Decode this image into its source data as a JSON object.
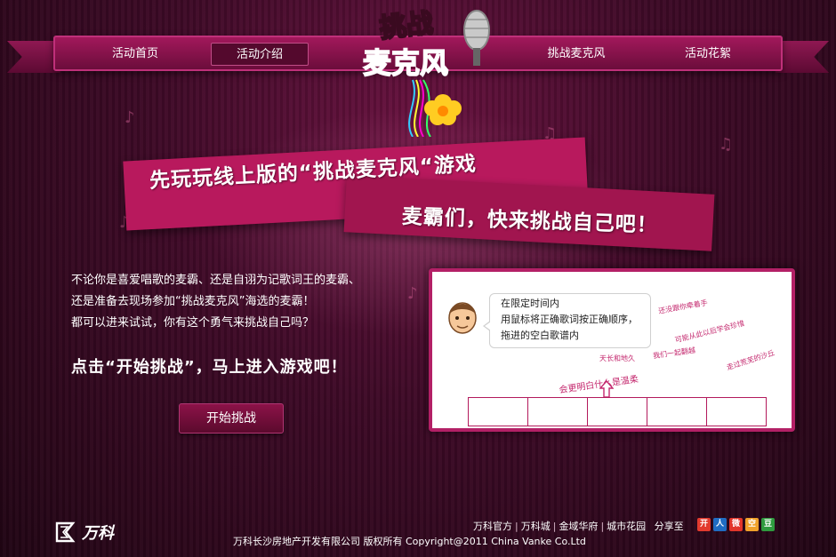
{
  "nav": {
    "items": [
      {
        "label": "活动首页"
      },
      {
        "label": "活动介绍"
      },
      {
        "label": "挑战麦克风"
      },
      {
        "label": "活动花絮"
      }
    ],
    "active": "活动介绍"
  },
  "logo": {
    "line1": "挑战",
    "line2": "麦克风"
  },
  "banner": {
    "line1": "先玩玩线上版的“挑战麦克风“游戏",
    "line2": "麦霸们，快来挑战自己吧！"
  },
  "intro": {
    "lines": [
      "不论你是喜爱唱歌的麦霸、还是自诩为记歌词王的麦霸、",
      "还是准备去现场参加“挑战麦克风”海选的麦霸！",
      "都可以进来试试，你有这个勇气来挑战自己吗？"
    ],
    "call_to_action": "点击“开始挑战”，马上进入游戏吧！"
  },
  "start_button": {
    "label": "开始挑战"
  },
  "preview": {
    "bubble_lines": [
      "在限定时间内",
      "用鼠标将正确歌词按正确顺序，",
      "拖进的空白歌谱内"
    ],
    "lyrics": [
      "还没跟你牵着手",
      "可能从此以后学会珍惜",
      "走过荒芜的沙丘",
      "天长和地久",
      "我们一起翻越"
    ],
    "main_lyric": "会更明白什么是温柔",
    "slot_count": 5
  },
  "footer": {
    "brand": "万科",
    "links": [
      "万科官方",
      "万科城",
      "金域华府",
      "城市花园"
    ],
    "share_label": "分享至",
    "share_icons": [
      {
        "name": "kaixin-icon",
        "glyph": "开",
        "color": "#e23a2e"
      },
      {
        "name": "renren-icon",
        "glyph": "人",
        "color": "#1f6cc2"
      },
      {
        "name": "weibo-icon",
        "glyph": "微",
        "color": "#e2352a"
      },
      {
        "name": "qzone-icon",
        "glyph": "空",
        "color": "#f0a12a"
      },
      {
        "name": "douban-icon",
        "glyph": "豆",
        "color": "#2e9a3e"
      }
    ],
    "copyright": "万科长沙房地产开发有限公司 版权所有    Copyright@2011 China Vanke Co.Ltd"
  }
}
